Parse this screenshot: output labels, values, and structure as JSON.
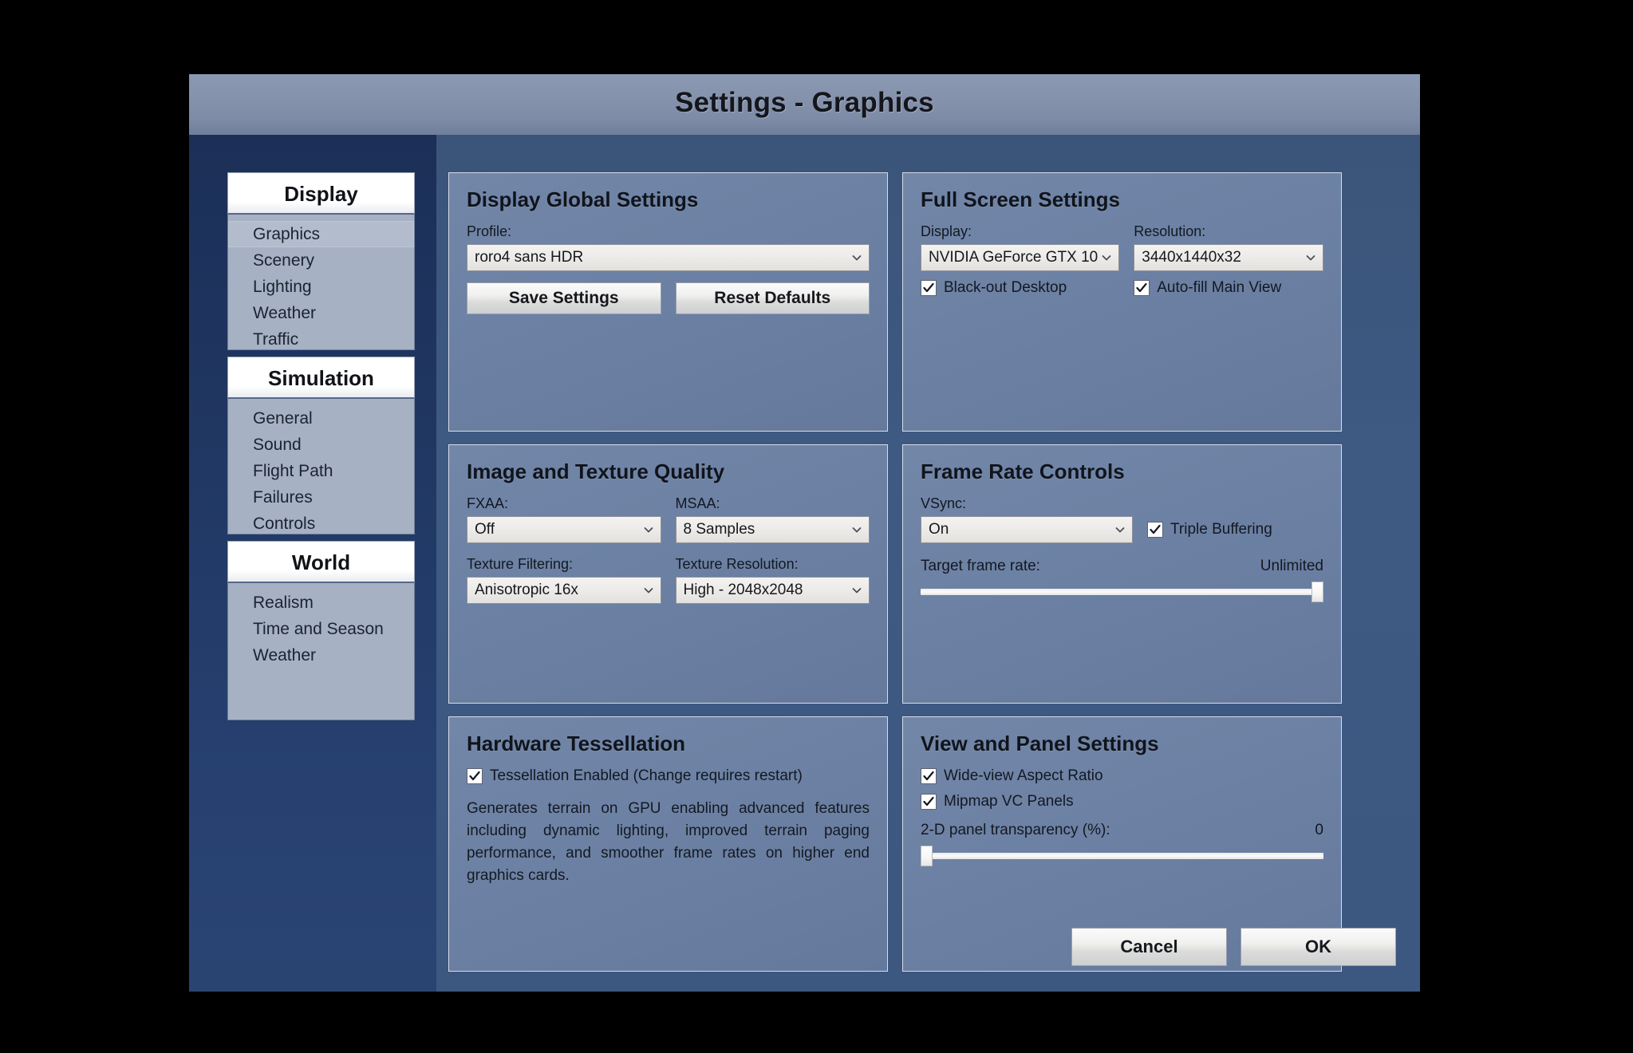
{
  "window": {
    "title": "Settings - Graphics"
  },
  "sidebar": {
    "groups": [
      {
        "header": "Display",
        "items": [
          {
            "label": "Graphics",
            "selected": true
          },
          {
            "label": "Scenery",
            "selected": false
          },
          {
            "label": "Lighting",
            "selected": false
          },
          {
            "label": "Weather",
            "selected": false
          },
          {
            "label": "Traffic",
            "selected": false
          }
        ]
      },
      {
        "header": "Simulation",
        "items": [
          {
            "label": "General",
            "selected": false
          },
          {
            "label": "Sound",
            "selected": false
          },
          {
            "label": "Flight Path",
            "selected": false
          },
          {
            "label": "Failures",
            "selected": false
          },
          {
            "label": "Controls",
            "selected": false
          }
        ]
      },
      {
        "header": "World",
        "items": [
          {
            "label": "Realism",
            "selected": false
          },
          {
            "label": "Time and Season",
            "selected": false
          },
          {
            "label": "Weather",
            "selected": false
          }
        ]
      }
    ]
  },
  "panels": {
    "display_global": {
      "title": "Display Global Settings",
      "profile_label": "Profile:",
      "profile_value": "roro4 sans HDR",
      "save_button": "Save Settings",
      "reset_button": "Reset Defaults",
      "chevron_icon": "chevron-down-icon"
    },
    "full_screen": {
      "title": "Full Screen Settings",
      "display_label": "Display:",
      "display_value": "NVIDIA GeForce GTX 10",
      "resolution_label": "Resolution:",
      "resolution_value": "3440x1440x32",
      "blackout_label": "Black-out Desktop",
      "blackout_checked": true,
      "autofill_label": "Auto-fill Main View",
      "autofill_checked": true,
      "chevron_icon": "chevron-down-icon",
      "check_icon": "checkmark-icon"
    },
    "image_texture": {
      "title": "Image and Texture Quality",
      "fxaa_label": "FXAA:",
      "fxaa_value": "Off",
      "msaa_label": "MSAA:",
      "msaa_value": "8 Samples",
      "texture_filtering_label": "Texture Filtering:",
      "texture_filtering_value": "Anisotropic 16x",
      "texture_resolution_label": "Texture Resolution:",
      "texture_resolution_value": "High - 2048x2048",
      "chevron_icon": "chevron-down-icon"
    },
    "frame_rate": {
      "title": "Frame Rate Controls",
      "vsync_label": "VSync:",
      "vsync_value": "On",
      "triple_buffering_label": "Triple Buffering",
      "triple_buffering_checked": true,
      "target_frame_rate_label": "Target frame rate:",
      "target_frame_rate_value": "Unlimited",
      "target_frame_rate_percent": 100,
      "chevron_icon": "chevron-down-icon",
      "check_icon": "checkmark-icon"
    },
    "tessellation": {
      "title": "Hardware Tessellation",
      "enabled_label": "Tessellation Enabled (Change requires restart)",
      "enabled_checked": true,
      "description": "Generates terrain on GPU enabling advanced features including dynamic lighting, improved terrain paging performance, and smoother frame rates on higher end graphics cards.",
      "check_icon": "checkmark-icon"
    },
    "view_panel": {
      "title": "View and Panel Settings",
      "wide_view_label": "Wide-view Aspect Ratio",
      "wide_view_checked": true,
      "mipmap_label": "Mipmap VC Panels",
      "mipmap_checked": true,
      "transparency_label": "2-D panel transparency (%):",
      "transparency_value": "0",
      "transparency_percent": 0,
      "check_icon": "checkmark-icon"
    }
  },
  "footer": {
    "cancel_label": "Cancel",
    "ok_label": "OK"
  },
  "colors": {
    "dialog_background": "#3c5780",
    "titlebar": "#8491ab",
    "nav_strip": "#203762",
    "panel_fill": "#6d82a4",
    "nav_list_fill": "#a6b1c4",
    "nav_selected": "#b2bccd",
    "control_fill": "#eceae7"
  }
}
